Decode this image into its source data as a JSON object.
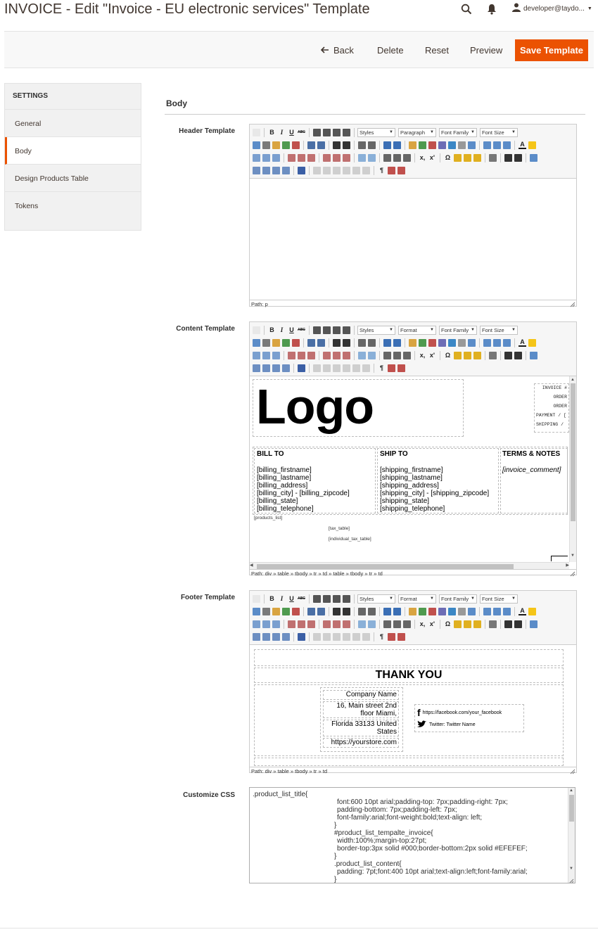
{
  "header": {
    "title": "INVOICE - Edit \"Invoice - EU electronic services\" Template",
    "user": "developer@taydo..."
  },
  "actions": {
    "back": "Back",
    "delete": "Delete",
    "reset": "Reset",
    "preview": "Preview",
    "save": "Save Template"
  },
  "sidebar": {
    "heading": "SETTINGS",
    "items": [
      "General",
      "Body",
      "Design Products Table",
      "Tokens"
    ],
    "active": "Body"
  },
  "section": {
    "title": "Body"
  },
  "fields": {
    "header_label": "Header Template",
    "content_label": "Content Template",
    "footer_label": "Footer Template",
    "css_label": "Customize CSS"
  },
  "toolbar": {
    "styles": "Styles",
    "paragraph": "Paragraph",
    "format": "Format",
    "font_family": "Font Family",
    "font_size": "Font Size"
  },
  "header_editor": {
    "path": "Path: p"
  },
  "content_editor": {
    "path": "Path: div » table » tbody » tr » td » table » tbody » tr » td",
    "logo": "Logo",
    "invoice_lines": [
      "INVOICE #",
      "ORDER",
      "ORDER",
      "PAYMENT / [",
      "SHIPPING /"
    ],
    "bill_to": {
      "title": "BILL TO",
      "lines": [
        "[billing_firstname]",
        "[billing_lastname]",
        "[billing_address]",
        "[billing_city] - [billing_zipcode]",
        "[billing_state]",
        "[billing_telephone]"
      ]
    },
    "ship_to": {
      "title": "SHIP TO",
      "lines": [
        "[shipping_firstname]",
        "[shipping_lastname]",
        "[shipping_address]",
        "[shipping_city] - [shipping_zipcode]",
        "[shipping_state]",
        "[shipping_telephone]"
      ]
    },
    "terms": {
      "title": "TERMS & NOTES",
      "comment": "[invoice_comment]"
    },
    "products_list": "[products_list]",
    "tax_table": "[tax_table]",
    "individual_tax_table": "[individual_tax_table]"
  },
  "footer_editor": {
    "path": "Path: div » table » tbody » tr » td",
    "thank_you": "THANK YOU",
    "company": "Company Name",
    "street_1": "16, Main street 2nd",
    "street_2": "floor Miami,",
    "city_1": "Florida 33133 United",
    "city_2": "States",
    "website": "https://yourstore.com",
    "facebook": "https://facebook.com/your_facebook",
    "twitter": "Twitter: Twitter Name"
  },
  "css": {
    "lines": [
      ".product_list_title{",
      "font:600 10pt arial;padding-top: 7px;padding-right: 7px;",
      "padding-bottom: 7px;padding-left: 7px;",
      "font-family:arial;font-weight:bold;text-align: left;",
      "}",
      "#product_list_tempalte_invoice{",
      "width:100%;margin-top:27pt;",
      "border-top:3px solid #000;border-bottom:2px solid #EFEFEF;",
      "}",
      ".product_list_content{",
      "padding: 7pt;font:400 10pt arial;text-align:left;font-family:arial;",
      "}"
    ]
  },
  "colors": {
    "accent": "#eb5202",
    "sidebar_bg": "#f1f1f1",
    "action_bar_bg": "#f8f8f8"
  }
}
